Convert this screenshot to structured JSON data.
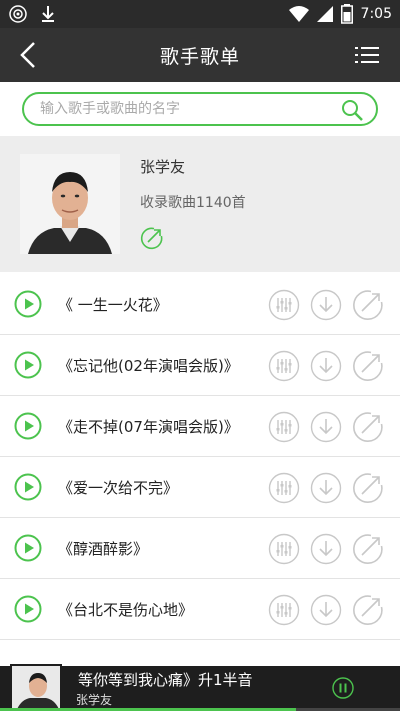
{
  "status_bar": {
    "time": "7:05"
  },
  "header": {
    "title": "歌手歌单"
  },
  "search": {
    "placeholder": "输入歌手或歌曲的名字",
    "value": ""
  },
  "artist": {
    "name": "张学友",
    "song_count_text": "收录歌曲1140首"
  },
  "songs": [
    {
      "title": "《 一生一火花》"
    },
    {
      "title": "《忘记他(02年演唱会版)》"
    },
    {
      "title": "《走不掉(07年演唱会版)》"
    },
    {
      "title": "《爱一次给不完》"
    },
    {
      "title": "《醇酒醉影》"
    },
    {
      "title": "《台北不是伤心地》"
    }
  ],
  "player": {
    "now_playing": "等你等到我心痛》升1半音",
    "artist": "张学友",
    "progress_fraction": 0.74
  },
  "colors": {
    "accent": "#4cc34e",
    "app_bar": "#333333",
    "card_bg": "#ededed",
    "icon_gray": "#bdbdbd"
  }
}
